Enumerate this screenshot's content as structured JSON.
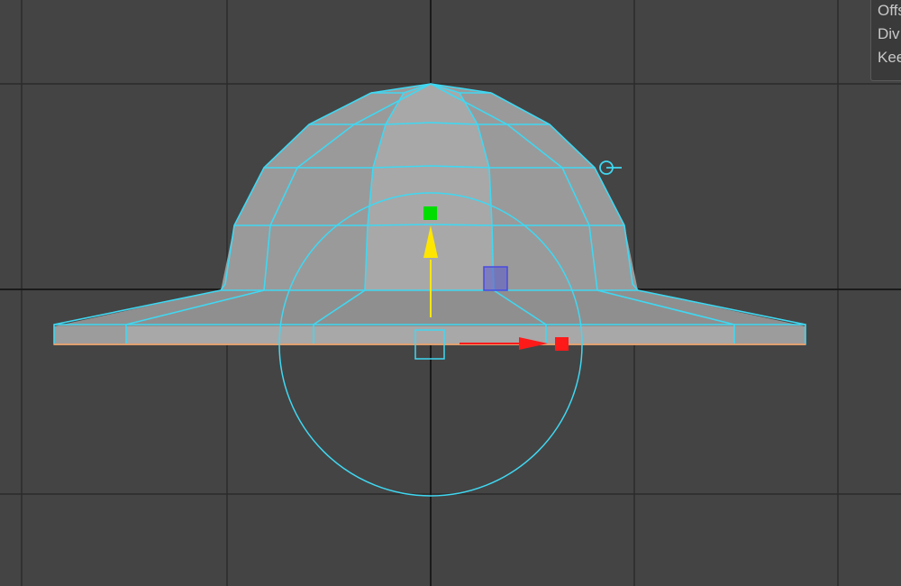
{
  "viewport": {
    "background_color": "#444444",
    "grid_color": "#2b2b2b",
    "axis_color": "#1a1a1a"
  },
  "model": {
    "wireframe_color": "#3fd8f2",
    "face_color": "#9a9a9a",
    "bottom_edge_color": "#e0a070"
  },
  "manipulator": {
    "y_axis_color": "#ffe600",
    "x_axis_color": "#ff1a1a",
    "y_handle_color": "#00dd00",
    "center_plane_color": "#5a5ad0",
    "ring_color": "#3fd8f2"
  },
  "attributes_panel": {
    "rows": [
      {
        "label": "Offs"
      },
      {
        "label": "Div"
      },
      {
        "label": "Kee"
      }
    ]
  }
}
